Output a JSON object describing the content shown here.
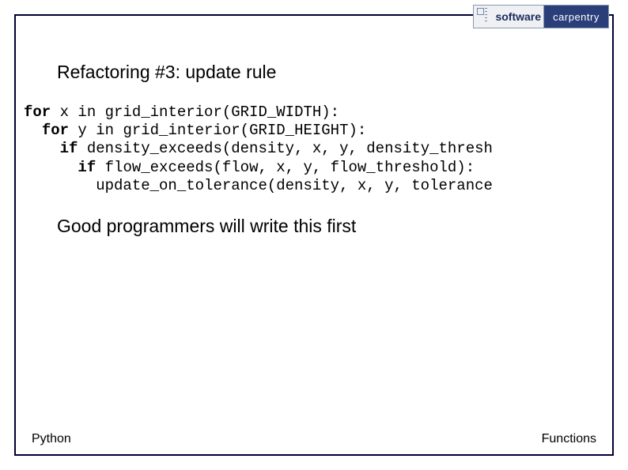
{
  "logo": {
    "left": "software",
    "right": "carpentry"
  },
  "slide": {
    "heading": "Refactoring #3: update rule",
    "code": {
      "kw_for1": "for",
      "line1_rest": " x in grid_interior(GRID_WIDTH):",
      "kw_for2": "for",
      "line2_rest": " y in grid_interior(GRID_HEIGHT):",
      "kw_if1": "if",
      "line3_rest": " density_exceeds(density, x, y, density_thresh",
      "kw_if2": "if",
      "line4_rest": " flow_exceeds(flow, x, y, flow_threshold):",
      "line5": "        update_on_tolerance(density, x, y, tolerance"
    },
    "body": "Good programmers will write this first"
  },
  "footer": {
    "left": "Python",
    "right": "Functions"
  }
}
